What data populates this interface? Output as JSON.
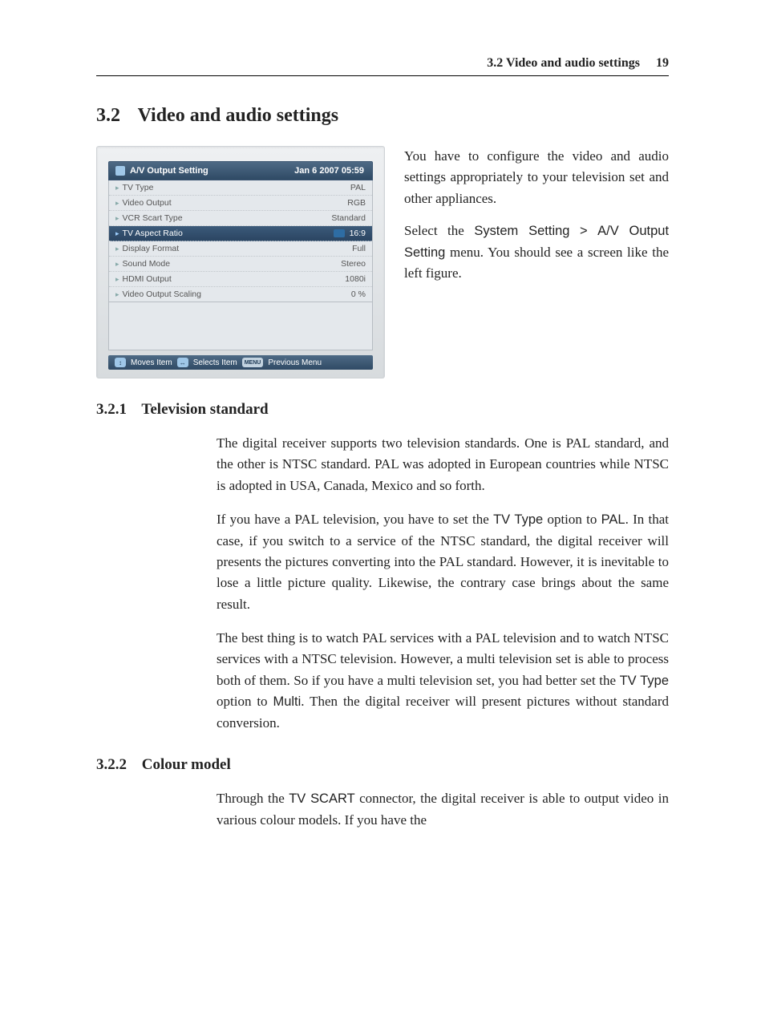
{
  "header": {
    "section_label": "3.2 Video and audio settings",
    "page_number": "19"
  },
  "section": {
    "number": "3.2",
    "title": "Video and audio settings"
  },
  "figure": {
    "title": "A/V Output Setting",
    "datetime": "Jan 6 2007 05:59",
    "rows": [
      {
        "label": "TV Type",
        "value": "PAL",
        "selected": false
      },
      {
        "label": "Video Output",
        "value": "RGB",
        "selected": false
      },
      {
        "label": "VCR Scart Type",
        "value": "Standard",
        "selected": false
      },
      {
        "label": "TV Aspect Ratio",
        "value": "16:9",
        "selected": true
      },
      {
        "label": "Display Format",
        "value": "Full",
        "selected": false
      },
      {
        "label": "Sound Mode",
        "value": "Stereo",
        "selected": false
      },
      {
        "label": "HDMI Output",
        "value": "1080i",
        "selected": false
      },
      {
        "label": "Video Output Scaling",
        "value": "0 %",
        "selected": false
      }
    ],
    "hints": {
      "move": "Moves Item",
      "select": "Selects Item",
      "menu_key": "MENU",
      "prev": "Previous Menu"
    }
  },
  "intro": {
    "p1": "You have to configure the video and audio settings appropriately to your television set and other appliances.",
    "p2_a": "Select the ",
    "p2_menu1": "System Setting",
    "p2_gt": ">",
    "p2_menu2": "A/V Output Setting",
    "p2_b": " menu. You should see a screen like the left figure."
  },
  "sub1": {
    "number": "3.2.1",
    "title": "Television standard",
    "p1": "The digital receiver supports two television standards. One is PAL standard, and the other is NTSC standard. PAL was adopted in European countries while NTSC is adopted in USA, Canada, Mexico and so forth.",
    "p2_a": "If you have a PAL television, you have to set the ",
    "p2_opt": "TV Type",
    "p2_b": " option to ",
    "p2_val": "PAL",
    "p2_c": ". In that case, if you switch to a service of the NTSC standard, the digital receiver will presents the pictures converting into the PAL standard. However, it is inevitable to lose a little picture quality. Likewise, the contrary case brings about the same result.",
    "p3_a": "The best thing is to watch PAL services with a PAL television and to watch NTSC services with a NTSC television. However, a multi television set is able to process both of them. So if you have a multi television set, you had better set the ",
    "p3_opt": "TV Type",
    "p3_b": " option to ",
    "p3_val": "Multi",
    "p3_c": ". Then the digital receiver will present pictures without standard conversion."
  },
  "sub2": {
    "number": "3.2.2",
    "title": "Colour model",
    "p1_a": "Through the ",
    "p1_conn": "TV SCART",
    "p1_b": " connector, the digital receiver is able to output video in various colour models. If you have the"
  }
}
